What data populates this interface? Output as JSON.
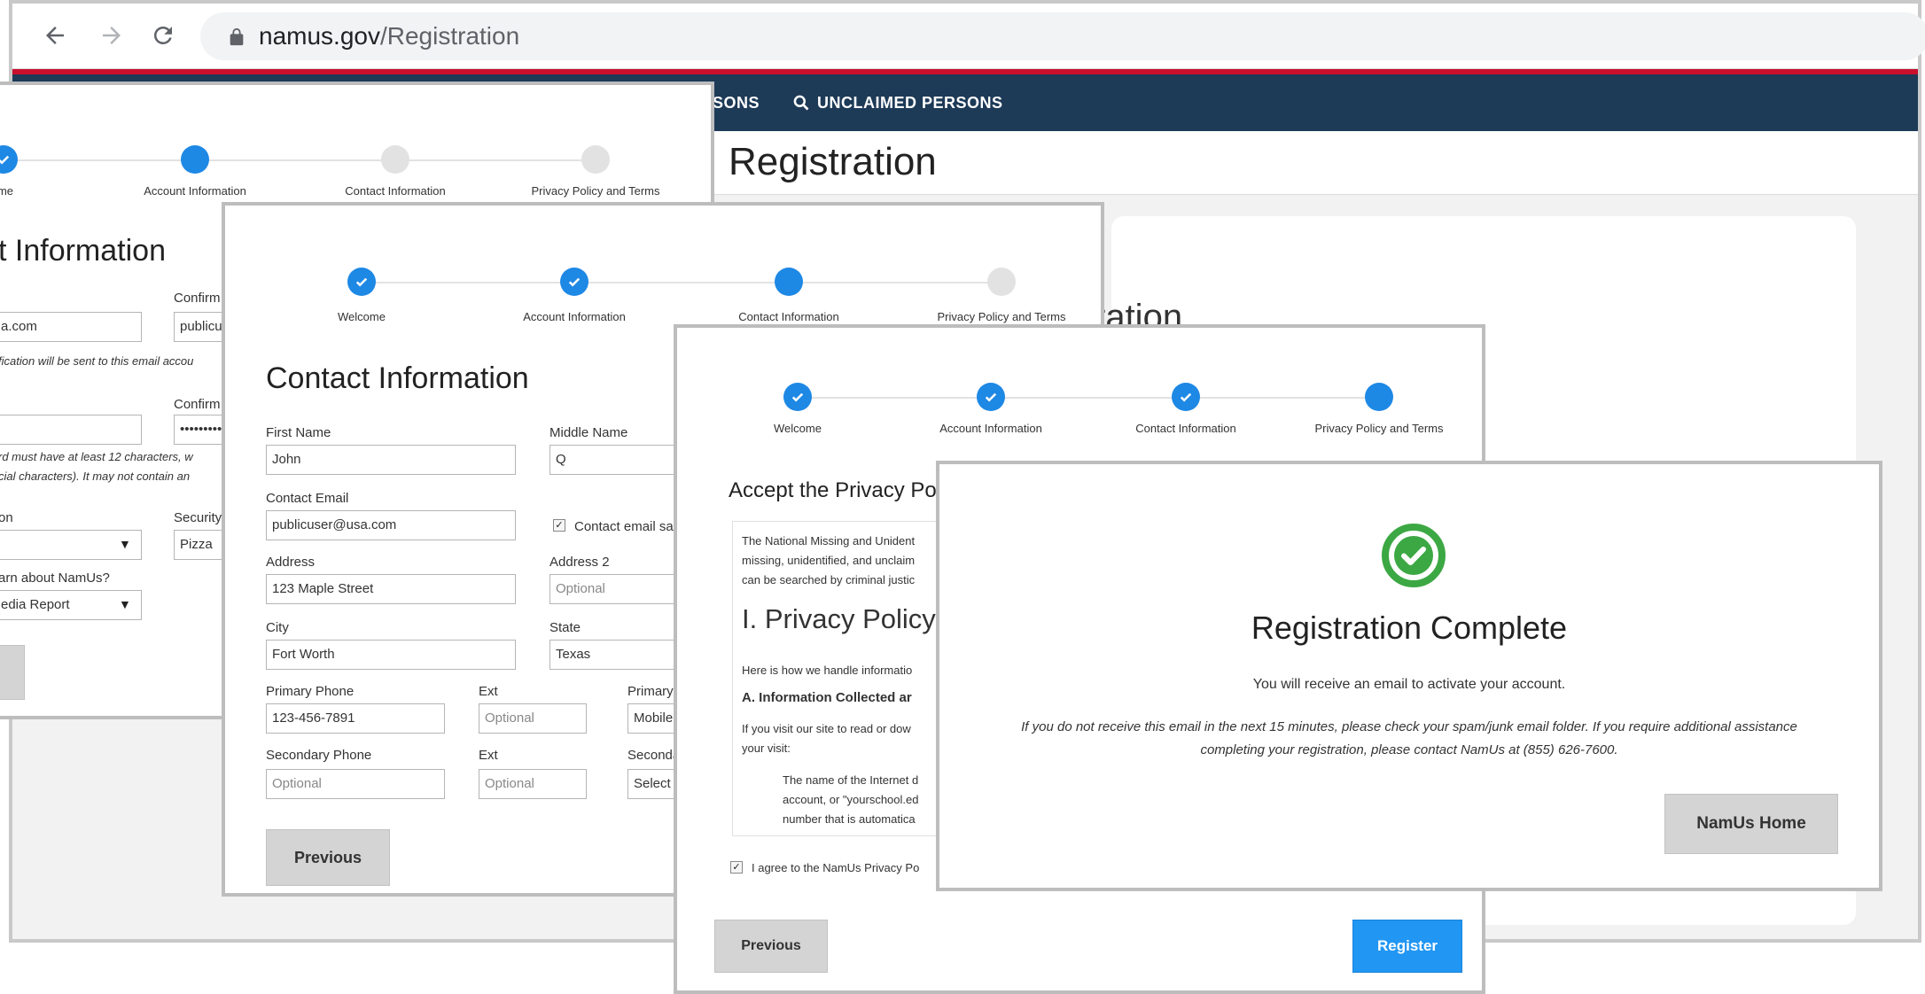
{
  "browser": {
    "url_host": "namus.gov",
    "url_path": "/Registration",
    "nav_item_partial": "SONS",
    "nav_item": "UNCLAIMED PERSONS",
    "page_title": "Registration",
    "background_heading_partial": "ration"
  },
  "account_panel": {
    "steps": [
      "me",
      "Account Information",
      "Contact Information",
      "Privacy Policy and Terms"
    ],
    "heading": "t Information",
    "confirm_email_label": "Confirm",
    "email_value": "a.com",
    "confirm_email_value": "publicu",
    "email_note": "fication will be sent to this email accou",
    "confirm_password_label": "Confirm",
    "password_mask": "•••••••••••",
    "password_note_1": "rd must have at least 12 characters, w",
    "password_note_2": "cial characters). It may not contain an",
    "question_label": "on",
    "security_label": "Security",
    "security_answer": "Pizza",
    "learn_label": "arn about NamUs?",
    "learn_value": "edia Report"
  },
  "contact_panel": {
    "steps": [
      "Welcome",
      "Account Information",
      "Contact Information",
      "Privacy Policy and Terms"
    ],
    "heading": "Contact Information",
    "first_name_label": "First Name",
    "first_name_value": "John",
    "middle_name_label": "Middle Name",
    "middle_name_value": "Q",
    "contact_email_label": "Contact Email",
    "contact_email_value": "publicuser@usa.com",
    "contact_email_checkbox_label": "Contact email sa",
    "address_label": "Address",
    "address_value": "123 Maple Street",
    "address2_label": "Address 2",
    "address2_placeholder": "Optional",
    "city_label": "City",
    "city_value": "Fort Worth",
    "state_label": "State",
    "state_value": "Texas",
    "primary_phone_label": "Primary Phone",
    "primary_phone_value": "123-456-7891",
    "ext_label": "Ext",
    "ext_placeholder": "Optional",
    "primary_type_label": "Primary",
    "primary_type_value": "Mobile",
    "secondary_phone_label": "Secondary Phone",
    "secondary_phone_placeholder": "Optional",
    "ext2_label": "Ext",
    "ext2_placeholder": "Optional",
    "secondary_type_label": "Seconda",
    "secondary_type_value": "Select P",
    "previous_button": "Previous"
  },
  "privacy_panel": {
    "steps": [
      "Welcome",
      "Account Information",
      "Contact Information",
      "Privacy Policy and Terms"
    ],
    "heading": "Accept the Privacy Po",
    "intro_1": "The National Missing and Unident",
    "intro_2": "missing, unidentified, and unclaim",
    "intro_3": "can be searched by criminal justic",
    "policy_heading": "I. Privacy Policy",
    "handle_text": "Here is how we handle informatio",
    "section_a": "A. Information Collected ar",
    "visit_1": "If you visit our site to read or dow",
    "visit_2": "your visit:",
    "item_1": "The name of the Internet d",
    "item_2": "account, or \"yourschool.ed",
    "item_3": "number that is automatica",
    "agree_label": "I agree to the NamUs Privacy Po",
    "previous_button": "Previous",
    "register_button": "Register"
  },
  "complete_panel": {
    "title": "Registration Complete",
    "line1": "You will receive an email to activate your account.",
    "line2": "If you do not receive this email in the next 15 minutes, please check your spam/junk email folder. If you require additional assistance",
    "line3": "completing your registration, please contact NamUs at (855) 626-7600.",
    "home_button": "NamUs Home"
  },
  "colors": {
    "accent": "#1e88e5",
    "success": "#3ca843",
    "navbar": "#1d3a57",
    "redline": "#c8102e"
  }
}
